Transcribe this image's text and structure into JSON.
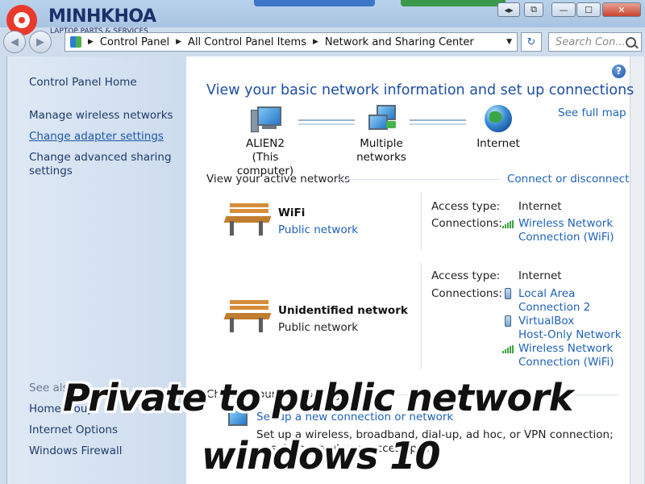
{
  "logo": {
    "name": "MINHKHOA",
    "tagline": "LAPTOP PARTS & SERVICES"
  },
  "window_controls": {
    "minimize": "—",
    "maximize": "☐",
    "close": "✕"
  },
  "address_bar": {
    "crumbs": [
      "Control Panel",
      "All Control Panel Items",
      "Network and Sharing Center"
    ],
    "search_placeholder": "Search Con..."
  },
  "left_pane": {
    "home": "Control Panel Home",
    "tasks": [
      "Manage wireless networks",
      "Change adapter settings",
      "Change advanced sharing",
      "settings"
    ],
    "see_also_label": "See also",
    "see_also": [
      "HomeGroup",
      "Internet Options",
      "Windows Firewall"
    ]
  },
  "main": {
    "heading": "View your basic network information and set up connections",
    "see_full_map": "See full map",
    "map": {
      "computer_name": "ALIEN2",
      "computer_sub": "(This computer)",
      "middle": "Multiple networks",
      "internet": "Internet"
    },
    "active_label": "View your active networks",
    "connect_disconnect": "Connect or disconnect",
    "networks": [
      {
        "name": "WiFi",
        "category": "Public network",
        "access_type_label": "Access type:",
        "access_type": "Internet",
        "connections_label": "Connections:",
        "connections": [
          "Wireless Network",
          "Connection (WiFi)"
        ]
      },
      {
        "name": "Unidentified network",
        "category": "Public network",
        "access_type_label": "Access type:",
        "access_type": "Internet",
        "connections_label": "Connections:",
        "connections": [
          "Local Area",
          "Connection 2",
          "VirtualBox",
          "Host-Only Network",
          "Wireless Network",
          "Connection (WiFi)"
        ]
      }
    ],
    "change_settings_label": "Change your networking settings",
    "setup_link": "Set up a new connection or network",
    "setup_desc": "Set up a wireless, broadband, dial-up, ad hoc, or VPN connection; or set up a router or access point."
  },
  "caption": {
    "line1": "Private to public network",
    "line2": "windows 10"
  },
  "colors": {
    "link": "#1e62b8",
    "heading": "#1e4fa3",
    "left_pane": "#dfe9f5"
  }
}
